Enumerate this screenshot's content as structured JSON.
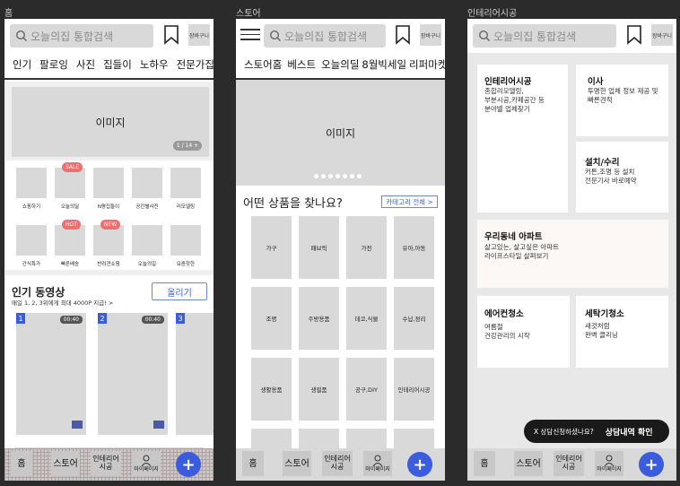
{
  "frames": [
    {
      "label": "홈"
    },
    {
      "label": "스토어"
    },
    {
      "label": "인테리어시공"
    }
  ],
  "search_placeholder": "오늘의집 통합검색",
  "cart_label": "장바구니",
  "home": {
    "nav": [
      "인기",
      "팔로잉",
      "사진",
      "집들이",
      "노하우",
      "전문가집들"
    ],
    "banner_text": "이미지",
    "pager": "1 / 14 +",
    "categories": [
      {
        "label": "쇼핑하기"
      },
      {
        "label": "오늘의딜",
        "badge": "SALE"
      },
      {
        "label": "N평집들이"
      },
      {
        "label": "공간별사진"
      },
      {
        "label": "리모델링"
      },
      {
        "label": "간식특가"
      },
      {
        "label": "빠른배송",
        "badge": "HOT"
      },
      {
        "label": "반려견쇼핑",
        "badge": "NEW"
      },
      {
        "label": "오늘의일"
      },
      {
        "label": "요즘핫한"
      }
    ],
    "video_title": "인기 동영상",
    "video_sub": "매일 1, 2, 3위에게 최대 4000P 지급! >",
    "upload_label": "올리기",
    "videos": [
      {
        "num": "1",
        "duration": "00:40"
      },
      {
        "num": "2",
        "duration": "00:40"
      },
      {
        "num": "3",
        "duration": ""
      }
    ]
  },
  "store": {
    "nav": [
      "스토어홈",
      "베스트",
      "오늘의딜",
      "8월빅세일",
      "리퍼마켓"
    ],
    "banner_text": "이미지",
    "question": "어떤 상품을 찾나요?",
    "category_all": "카테고리 전체 >",
    "products": [
      "가구",
      "패브릭",
      "가전",
      "유아,아동",
      "조명",
      "주방용품",
      "데코,식물",
      "수납,정리",
      "생활용품",
      "생필품",
      "공구,DIY",
      "인테리어시공",
      "",
      "",
      "",
      ""
    ]
  },
  "interior": {
    "cards": [
      {
        "title": "인테리어시공",
        "desc": [
          "종합리모델링,",
          "부분시공,카페공간 등",
          "분야별 업체찾기"
        ]
      },
      {
        "title": "이사",
        "desc": [
          "투명한 업체 정보 제공 및",
          "빠른견적"
        ]
      },
      {
        "title": "설치/수리",
        "desc": [
          "커튼,조명 등 설치",
          "전문기사 바로예약"
        ]
      },
      {
        "title": "우리동네 아파트",
        "desc": [
          "살고있는, 살고싶은 아파트",
          "라이프스타일 살펴보기"
        ]
      },
      {
        "title": "에어컨청소",
        "desc": [
          "여름철",
          "건강관리의 시작"
        ]
      },
      {
        "title": "세탁기청소",
        "desc": [
          "새것처럼",
          "완벽 클리닝"
        ]
      }
    ],
    "toast_text": "X 상담신청하셨나요?",
    "toast_action": "상담내역 확인"
  },
  "tabs": {
    "home": "홈",
    "store": "스토어",
    "interior": "인테리어\n시공",
    "mypage": "마이페이지",
    "fab": "+"
  },
  "colors": {
    "accent": "#3b5ddd",
    "badge": "#f06e6e",
    "placeholder": "#d9d9d9"
  }
}
